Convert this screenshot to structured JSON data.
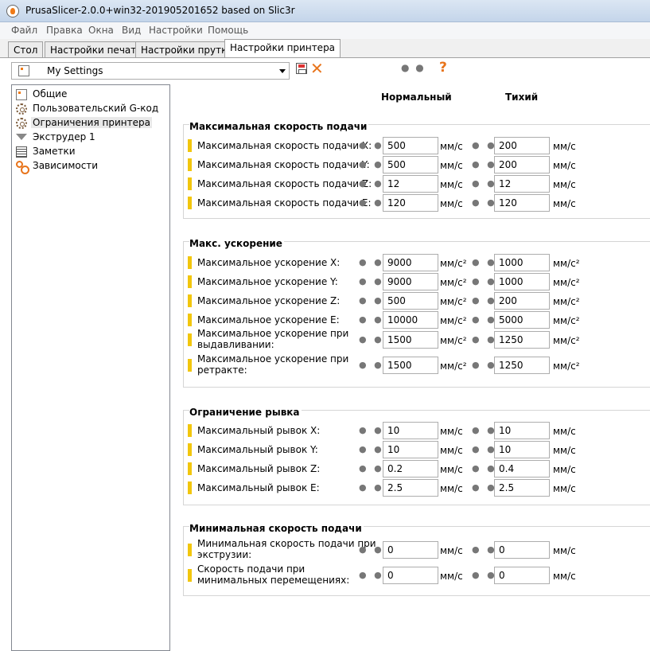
{
  "window": {
    "title": "PrusaSlicer-2.0.0+win32-201905201652 based on Slic3r"
  },
  "menu": [
    "Файл",
    "Правка",
    "Окна",
    "Вид",
    "Настройки",
    "Помощь"
  ],
  "tabs": [
    "Стол",
    "Настройки печати",
    "Настройки прутка",
    "Настройки принтера"
  ],
  "preset": {
    "name": "My Settings"
  },
  "toolbar": {
    "mode_dots": "● ●",
    "help": "?",
    "delete": "✕"
  },
  "tree": [
    "Общие",
    "Пользовательский G-код",
    "Ограничения принтера",
    "Экструдер 1",
    "Заметки",
    "Зависимости"
  ],
  "columns": {
    "normal": "Нормальный",
    "silent": "Тихий"
  },
  "dots": "● ●",
  "groups": [
    {
      "title": "Максимальная скорость подачи",
      "rows": [
        {
          "label": "Максимальная скорость подачи X:",
          "normal": "500",
          "silent": "200",
          "unit": "мм/с"
        },
        {
          "label": "Максимальная скорость подачи Y:",
          "normal": "500",
          "silent": "200",
          "unit": "мм/с"
        },
        {
          "label": "Максимальная скорость подачи Z:",
          "normal": "12",
          "silent": "12",
          "unit": "мм/с"
        },
        {
          "label": "Максимальная скорость подачи E:",
          "normal": "120",
          "silent": "120",
          "unit": "мм/с"
        }
      ]
    },
    {
      "title": "Макс. ускорение",
      "rows": [
        {
          "label": "Максимальное ускорение X:",
          "normal": "9000",
          "silent": "1000",
          "unit": "мм/с²"
        },
        {
          "label": "Максимальное ускорение Y:",
          "normal": "9000",
          "silent": "1000",
          "unit": "мм/с²"
        },
        {
          "label": "Максимальное ускорение Z:",
          "normal": "500",
          "silent": "200",
          "unit": "мм/с²"
        },
        {
          "label": "Максимальное ускорение E:",
          "normal": "10000",
          "silent": "5000",
          "unit": "мм/с²"
        },
        {
          "label": "Максимальное ускорение при\nвыдавливании:",
          "normal": "1500",
          "silent": "1250",
          "unit": "мм/с²"
        },
        {
          "label": "Максимальное ускорение при\nретракте:",
          "normal": "1500",
          "silent": "1250",
          "unit": "мм/с²"
        }
      ]
    },
    {
      "title": "Ограничение рывка",
      "rows": [
        {
          "label": "Максимальный рывок X:",
          "normal": "10",
          "silent": "10",
          "unit": "мм/с"
        },
        {
          "label": "Максимальный рывок Y:",
          "normal": "10",
          "silent": "10",
          "unit": "мм/с"
        },
        {
          "label": "Максимальный рывок Z:",
          "normal": "0.2",
          "silent": "0.4",
          "unit": "мм/с"
        },
        {
          "label": "Максимальный рывок E:",
          "normal": "2.5",
          "silent": "2.5",
          "unit": "мм/с"
        }
      ]
    },
    {
      "title": "Минимальная скорость подачи",
      "rows": [
        {
          "label": "Минимальная скорость подачи при\nэкструзии:",
          "normal": "0",
          "silent": "0",
          "unit": "мм/с"
        },
        {
          "label": "Скорость подачи при\nминимальных перемещениях:",
          "normal": "0",
          "silent": "0",
          "unit": "мм/с"
        }
      ]
    }
  ]
}
